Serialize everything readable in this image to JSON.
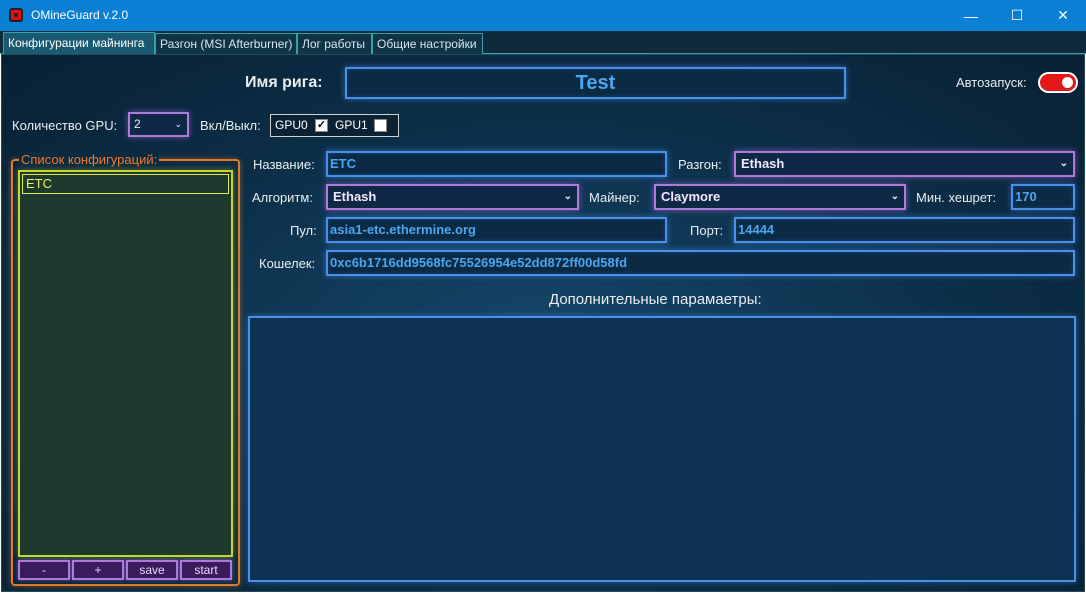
{
  "window": {
    "title": "OMineGuard v.2.0",
    "minimize": "—",
    "maximize": "☐",
    "close": "✕"
  },
  "tabs": [
    {
      "label": "Конфигурации майнинга"
    },
    {
      "label": "Разгон (MSI Afterburner)"
    },
    {
      "label": "Лог работы"
    },
    {
      "label": "Общие настройки"
    }
  ],
  "rig": {
    "label": "Имя рига:",
    "value": "Test"
  },
  "autostart": {
    "label": "Автозапуск:"
  },
  "gpu": {
    "count_label": "Количество GPU:",
    "count_value": "2",
    "onoff_label": "Вкл/Выкл:",
    "items": [
      {
        "label": "GPU0",
        "checked": "✓"
      },
      {
        "label": "GPU1",
        "checked": ""
      }
    ]
  },
  "configs": {
    "title": "Список конфигураций:",
    "items": [
      "ETC"
    ],
    "buttons": {
      "minus": "-",
      "plus": "+",
      "save": "save",
      "start": "start"
    }
  },
  "form": {
    "name_label": "Название:",
    "name_value": "ETC",
    "oc_label": "Разгон:",
    "oc_value": "Ethash",
    "algo_label": "Алгоритм:",
    "algo_value": "Ethash",
    "miner_label": "Майнер:",
    "miner_value": "Claymore",
    "minhash_label": "Мин. хешрет:",
    "minhash_value": "170",
    "pool_label": "Пул:",
    "pool_value": "asia1-etc.ethermine.org",
    "port_label": "Порт:",
    "port_value": "14444",
    "wallet_label": "Кошелек:",
    "wallet_value": "0xc6b1716dd9568fc75526954e52dd872ff00d58fd",
    "extra_label": "Дополнительные парамаетры:",
    "extra_value": ""
  },
  "colors": {
    "accent_blue": "#4a90e8",
    "accent_purple": "#b07ad8",
    "accent_orange": "#e07a24",
    "accent_yellow": "#c8d82a",
    "toggle_red": "#e41818"
  }
}
